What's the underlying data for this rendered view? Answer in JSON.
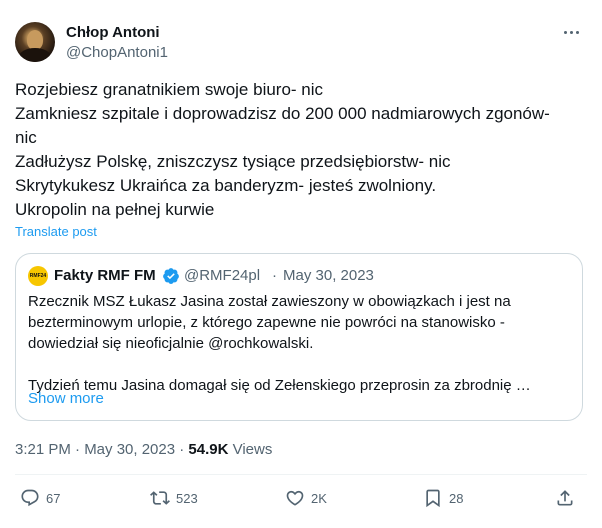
{
  "author": {
    "display_name": "Chłop Antoni",
    "handle": "@ChopAntoni1"
  },
  "tweet": {
    "lines": [
      "Rozjebiesz granatnikiem swoje biuro- nic",
      "Zamkniesz szpitale i doprowadzisz do 200 000 nadmiarowych zgonów-",
      "nic",
      "Zadłużysz Polskę, zniszczysz tysiące przedsiębiorstw- nic",
      "Skrytykukesz Ukraińca za banderyzm- jesteś zwolniony.",
      "Ukropolin na pełnej kurwie"
    ],
    "translate_label": "Translate post"
  },
  "quote": {
    "avatar_text": "RMF24",
    "display_name": "Fakty RMF FM",
    "handle": "@RMF24pl",
    "separator": "·",
    "date": "May 30, 2023",
    "lines": [
      "Rzecznik MSZ Łukasz Jasina został zawieszony w obowiązkach i jest na",
      "bezterminowym urlopie, z którego zapewne nie powróci na stanowisko -",
      "dowiedział się nieoficjalnie @rochkowalski.",
      "",
      "Tydzień temu Jasina domagał się od Zełenskiego przeprosin za zbrodnię …"
    ],
    "show_more": "Show more"
  },
  "meta": {
    "time_date": "3:21 PM · May 30, 2023 · ",
    "views_count": "54.9K",
    "views_label": " Views"
  },
  "actions": {
    "replies": "67",
    "reposts": "523",
    "likes": "2K",
    "bookmarks": "28"
  },
  "colors": {
    "accent": "#1d9bf0",
    "secondary_text": "#536471",
    "border": "#cfd9de"
  }
}
